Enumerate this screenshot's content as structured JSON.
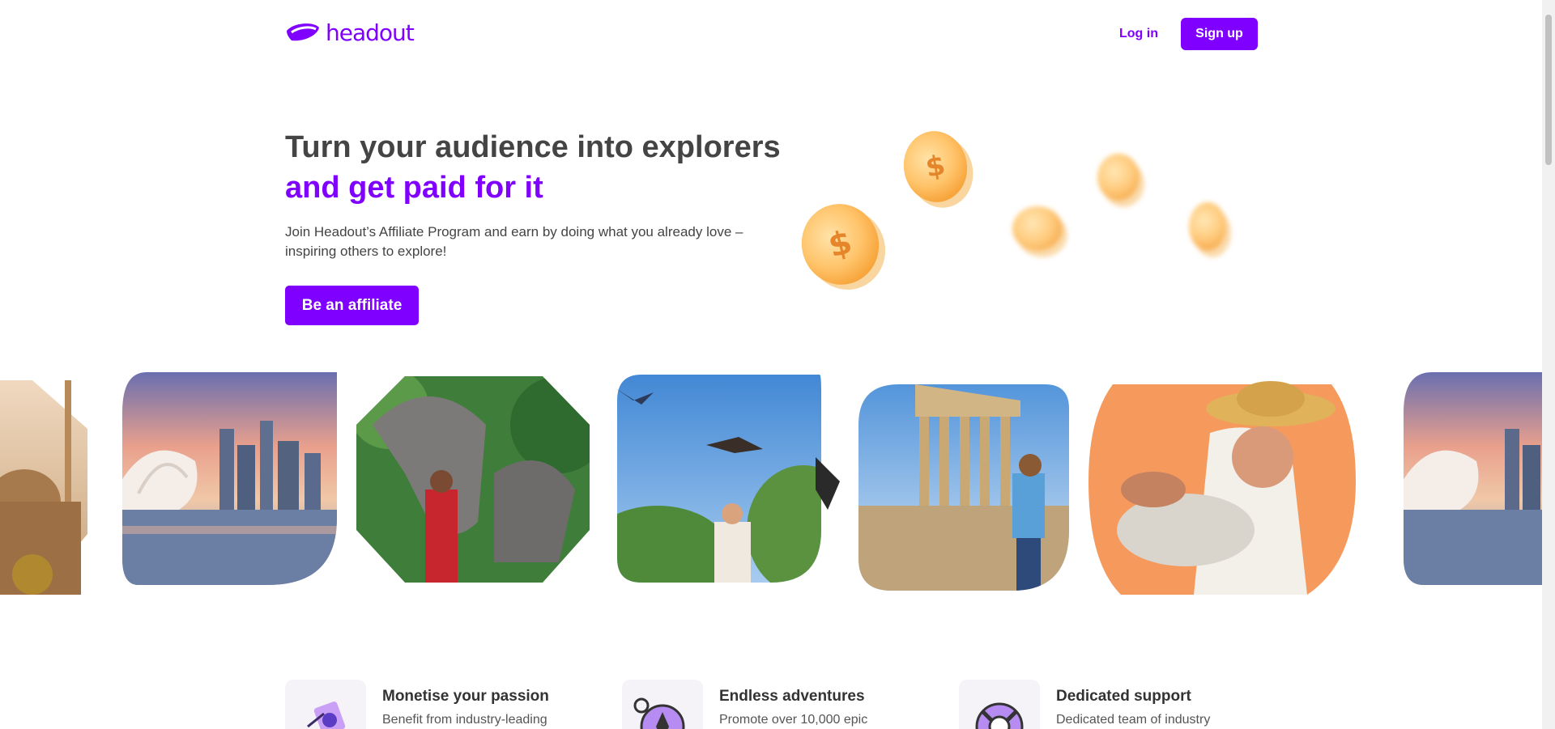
{
  "header": {
    "logo_text": "headout",
    "login_label": "Log in",
    "signup_label": "Sign up"
  },
  "hero": {
    "title": "Turn your audience into explorers",
    "title_accent": "and get paid for it",
    "subtitle": "Join Headout’s Affiliate Program and earn by doing what you already love – inspiring others to explore!",
    "cta_label": "Be an affiliate",
    "coin_symbol": "$"
  },
  "gallery": {
    "images": [
      {
        "name": "istanbul-mosque-image"
      },
      {
        "name": "singapore-skyline-image"
      },
      {
        "name": "elephants-image"
      },
      {
        "name": "birds-falconry-image"
      },
      {
        "name": "parthenon-image"
      },
      {
        "name": "cooking-class-image"
      },
      {
        "name": "singapore-skyline-image-repeat"
      }
    ]
  },
  "features": [
    {
      "title": "Monetise your passion",
      "desc": "Benefit from industry-leading",
      "icon": "money-icon"
    },
    {
      "title": "Endless adventures",
      "desc": "Promote over 10,000 epic",
      "icon": "compass-icon"
    },
    {
      "title": "Dedicated support",
      "desc": "Dedicated team of industry",
      "icon": "lifebuoy-icon"
    }
  ],
  "colors": {
    "brand": "#8000ff",
    "text": "#444444",
    "coin": "#ffc46b"
  }
}
